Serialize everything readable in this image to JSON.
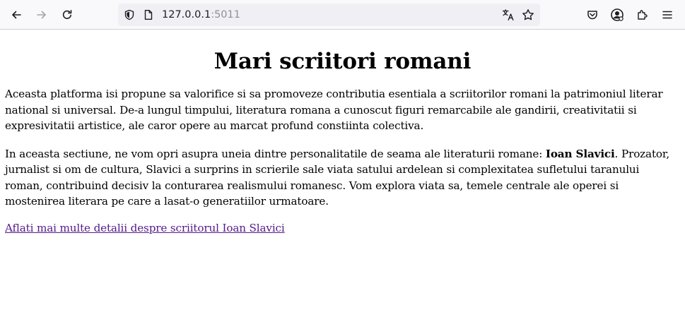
{
  "browser": {
    "url_host": "127.0.0.1",
    "url_port": ":5011",
    "icons": {
      "back": "back-arrow-icon",
      "forward": "forward-arrow-icon",
      "reload": "reload-icon",
      "tracking": "shield-icon",
      "page": "page-icon",
      "translate": "translate-icon",
      "bookmark": "star-icon",
      "pocket": "pocket-icon",
      "account": "account-icon",
      "extensions": "puzzle-icon",
      "menu": "hamburger-menu-icon"
    }
  },
  "page": {
    "title": "Mari scriitori romani",
    "paragraph1": "Aceasta platforma isi propune sa valorifice si sa promoveze contributia esentiala a scriitorilor romani la patrimoniul literar national si universal. De-a lungul timpului, literatura romana a cunoscut figuri remarcabile ale gandirii, creativitatii si expresivitatii artistice, ale caror opere au marcat profund constiinta colectiva.",
    "paragraph2_before": "In aceasta sectiune, ne vom opri asupra uneia dintre personalitatile de seama ale literaturii romane: ",
    "paragraph2_bold": "Ioan Slavici",
    "paragraph2_after": ". Prozator, jurnalist si om de cultura, Slavici a surprins in scrierile sale viata satului ardelean si complexitatea sufletului taranului roman, contribuind decisiv la conturarea realismului romanesc. Vom explora viata sa, temele centrale ale operei si mostenirea literara pe care a lasat-o generatiilor urmatoare.",
    "link_text": "Aflati mai multe detalii despre scriitorul Ioan Slavici",
    "link_color": "#551a8b"
  }
}
